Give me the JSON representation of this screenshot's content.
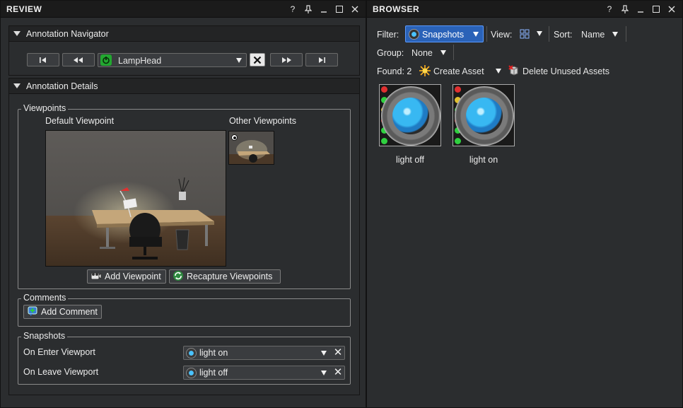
{
  "review": {
    "title": "REVIEW",
    "title_buttons": [
      "?",
      "⊥",
      "_",
      "☐",
      "✕"
    ],
    "navigator": {
      "header": "Annotation Navigator",
      "buttons": [
        "first",
        "prev",
        "next",
        "last"
      ],
      "current_annotation": "LampHead"
    },
    "details": {
      "header": "Annotation Details",
      "viewpoints": {
        "group_label": "Viewpoints",
        "default_label": "Default Viewpoint",
        "other_label": "Other Viewpoints",
        "add_button": "Add Viewpoint",
        "recapture_button": "Recapture Viewpoints"
      },
      "comments": {
        "group_label": "Comments",
        "add_button": "Add Comment"
      },
      "snapshots": {
        "group_label": "Snapshots",
        "on_enter_label": "On Enter Viewport",
        "on_enter_value": "light on",
        "on_leave_label": "On Leave Viewport",
        "on_leave_value": "light off"
      }
    }
  },
  "browser": {
    "title": "BROWSER",
    "filter_label": "Filter:",
    "filter_value": "Snapshots",
    "view_label": "View:",
    "sort_label": "Sort:",
    "sort_value": "Name",
    "group_label": "Group:",
    "group_value": "None",
    "found_text": "Found: 2",
    "create_asset": "Create Asset",
    "delete_unused": "Delete Unused Assets",
    "assets": [
      {
        "name": "light off"
      },
      {
        "name": "light on"
      }
    ]
  },
  "colors": {
    "panel_bg": "#2b2d2f",
    "title_bg": "#1b1b1b",
    "accent_blue": "#1e6fd9",
    "led_red": "#e03030",
    "led_yellow": "#e0c030",
    "led_green": "#30d040"
  }
}
